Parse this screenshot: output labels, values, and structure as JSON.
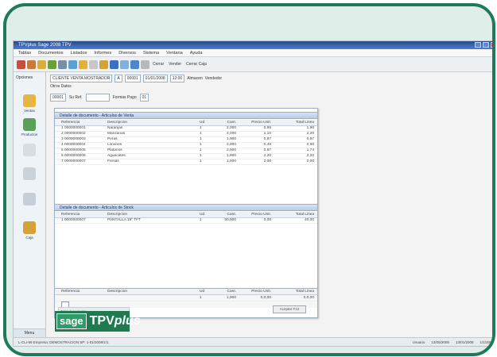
{
  "app": {
    "window_title": "TPVplus Sage 2008 TPV",
    "menu": [
      "Tablas",
      "Documentos",
      "Listados",
      "Informes",
      "Diversos",
      "Sistema",
      "Ventana",
      "Ayuda"
    ]
  },
  "toolbar": {
    "icons": [
      "user-icon",
      "users-icon",
      "brush-icon",
      "refresh-icon",
      "list-icon",
      "calendar-icon",
      "notes-icon",
      "document-icon",
      "open-folder-icon",
      "save-icon",
      "window-icon",
      "search-icon",
      "filter-icon"
    ],
    "labels": [
      "Cerrar",
      "Vender",
      "Cerrar Caja"
    ]
  },
  "left_panel": {
    "title": "Opciones",
    "items": [
      {
        "label": "Ventas",
        "icon": "folder-icon"
      },
      {
        "label": "Productos",
        "icon": "box-icon"
      },
      {
        "label": "",
        "icon": "document-icon"
      },
      {
        "label": "",
        "icon": "search-document-icon"
      },
      {
        "label": "",
        "icon": "report-icon"
      },
      {
        "label": "Caja",
        "icon": "printer-icon"
      }
    ],
    "bottom_label": "Menu"
  },
  "form": {
    "row1": [
      {
        "label": "CLIENTE VENTA MOSTRADOR",
        "value": "CLIENTE"
      },
      {
        "label": "Serie",
        "value": "A"
      },
      {
        "label": "N.",
        "value": "00001"
      },
      {
        "label": "Fecha",
        "value": "01/01/2008"
      },
      {
        "label": "Hora",
        "value": "12:00"
      },
      {
        "label": "Almacen",
        "value": "Central"
      },
      {
        "label": "Vendedor",
        "value": "General"
      }
    ],
    "row2": {
      "label": "Otros Datos",
      "value": ""
    },
    "row3": [
      {
        "label": "N.",
        "value": "00001"
      },
      {
        "label": "Su Ref.",
        "value": ""
      },
      {
        "label": "Formas Pago",
        "value": "01"
      }
    ]
  },
  "section1": {
    "title": "Detalle de documento - Articulos de Venta",
    "headers": [
      "Referencia",
      "Descripcion",
      "Ud",
      "Cant.",
      "Precio Unit.",
      "Total Linea"
    ],
    "rows": [
      [
        "1  0000000001",
        "Naranjas",
        "1",
        "2,000",
        "0,95",
        "1,90"
      ],
      [
        "2  0000000002",
        "Manzanas",
        "1",
        "2,000",
        "1,10",
        "2,20"
      ],
      [
        "3  0000000003",
        "Peras",
        "1",
        "1,000",
        "0,87",
        "0,87"
      ],
      [
        "4  0000000004",
        "Limones",
        "1",
        "2,000",
        "0,49",
        "0,98"
      ],
      [
        "5  0000000005",
        "Platanos",
        "1",
        "2,000",
        "0,87",
        "1,74"
      ],
      [
        "6  0000000006",
        "Aguacates",
        "1",
        "1,000",
        "2,20",
        "2,20"
      ],
      [
        "7  0000000007",
        "Fresas",
        "1",
        "1,000",
        "2,00",
        "2,00"
      ]
    ]
  },
  "section2": {
    "title": "Detalle de documento - Articulos de Stock",
    "headers": [
      "Referencia",
      "Descripcion",
      "Ud",
      "Cant.",
      "Precio Unit.",
      "Total Linea"
    ],
    "rows": [
      [
        "1  0000000007",
        "PANTALLA 19\" TFT",
        "1",
        "50,000",
        "0,00",
        "40,00"
      ]
    ]
  },
  "summary": {
    "headers": [
      "Referencia",
      "Descripcion",
      "Ud",
      "Cant.",
      "Precio Unit.",
      "Total Linea"
    ],
    "row": [
      "",
      "",
      "1",
      "1,000",
      "0,0,00",
      "0,0,00"
    ],
    "button_label": "Aceptar F12",
    "bar_text": "Total documento"
  },
  "logo": {
    "sage": "sage",
    "tpv": "TPV",
    "plus": "plus"
  },
  "statusbar": {
    "left": "L-CLI-99 Empresa: DEMOSTRACION SP: 1-01/2008/1/1",
    "right": [
      "Usuario",
      "13/05/2008",
      "13/01/2008",
      "1/1/2008"
    ]
  },
  "colors": {
    "frame": "#1e7a5a",
    "logo_bg": "#1f7a50",
    "header": "#b8cce6",
    "title_bar": "#284a8a"
  }
}
